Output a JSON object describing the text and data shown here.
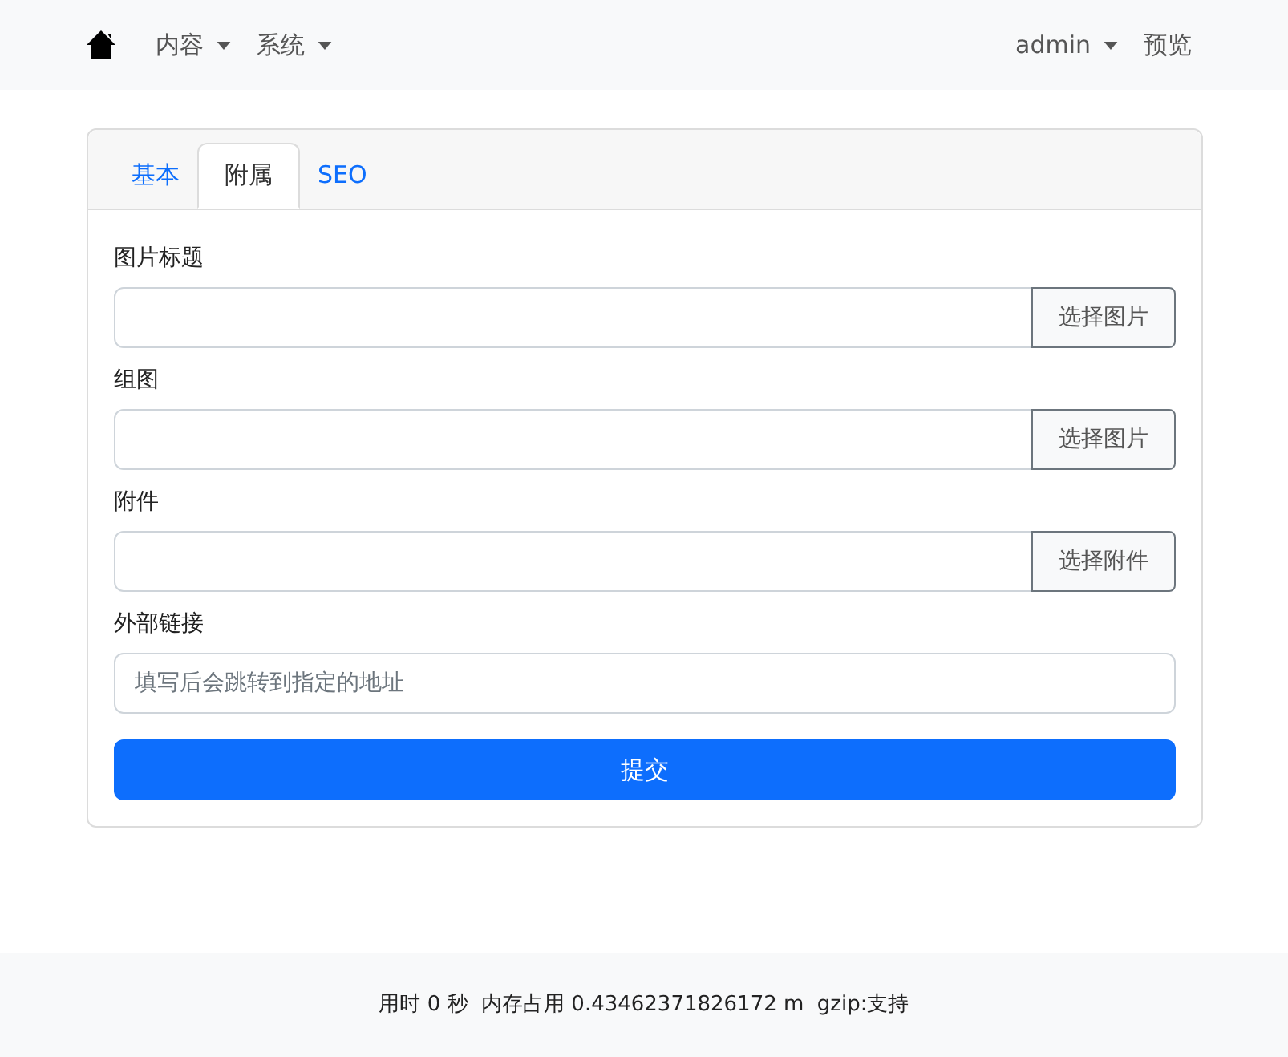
{
  "navbar": {
    "menus": [
      {
        "label": "内容",
        "dropdown": true
      },
      {
        "label": "系统",
        "dropdown": true
      }
    ],
    "right": [
      {
        "label": "admin",
        "dropdown": true
      },
      {
        "label": "预览",
        "dropdown": false
      }
    ]
  },
  "tabs": [
    {
      "label": "基本",
      "selected": false
    },
    {
      "label": "附属",
      "selected": true
    },
    {
      "label": "SEO",
      "selected": false
    }
  ],
  "fields": [
    {
      "kind": "file",
      "label": "图片标题",
      "button": "选择图片"
    },
    {
      "kind": "file",
      "label": "组图",
      "button": "选择图片"
    },
    {
      "kind": "file",
      "label": "附件",
      "button": "选择附件"
    },
    {
      "kind": "text",
      "label": "外部链接",
      "placeholder": "填写后会跳转到指定的地址"
    }
  ],
  "submit": "提交",
  "footer": "用时 0 秒  内存占用 0.43462371826172 m  gzip:支持"
}
